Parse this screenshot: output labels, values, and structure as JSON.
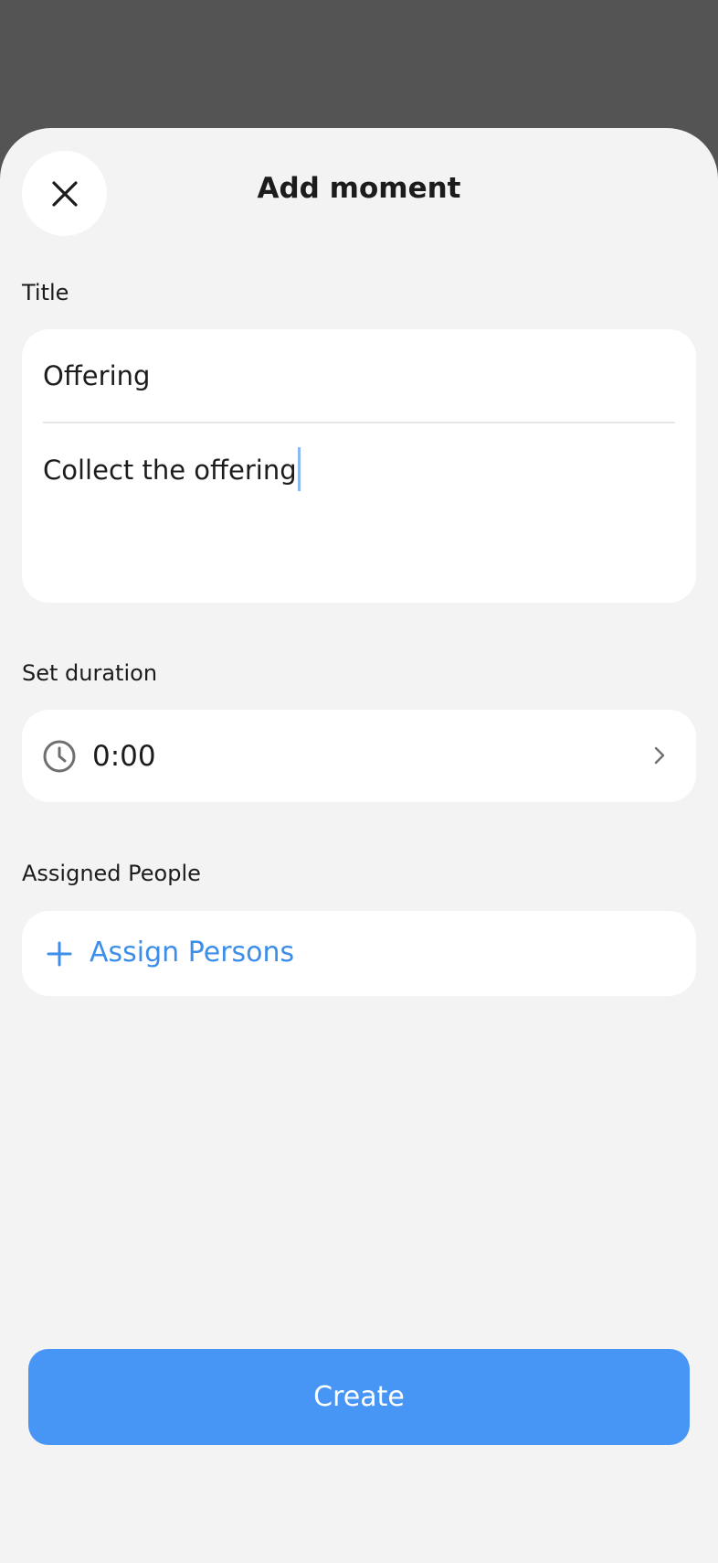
{
  "sheet": {
    "title": "Add moment"
  },
  "form": {
    "title_label": "Title",
    "title_value": "Offering",
    "description_value": "Collect the offering",
    "duration_label": "Set duration",
    "duration_value": "0:00",
    "people_label": "Assigned People",
    "assign_label": "Assign Persons"
  },
  "actions": {
    "create_label": "Create"
  },
  "icons": {
    "close": "close-icon",
    "clock": "clock-icon",
    "chevron": "chevron-right-icon",
    "plus": "plus-icon"
  },
  "colors": {
    "backdrop": "#545454",
    "sheet": "#f3f3f3",
    "card": "#ffffff",
    "accent": "#4795f5",
    "link": "#3d8ee8",
    "caret": "#8ab8f2"
  }
}
